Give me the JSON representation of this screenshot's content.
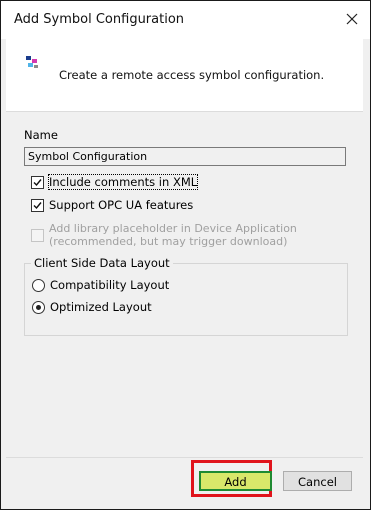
{
  "window": {
    "title": "Add Symbol Configuration"
  },
  "header": {
    "description": "Create a remote access symbol configuration.",
    "icon": "symbol-config-icon"
  },
  "name_field": {
    "label": "Name",
    "value": "Symbol Configuration"
  },
  "options": {
    "include_comments": {
      "label": "Include comments in XML",
      "checked": true
    },
    "support_opc_ua": {
      "label": "Support OPC UA features",
      "checked": true
    },
    "library_placeholder": {
      "label": "Add library placeholder in Device Application (recommended, but may trigger download)",
      "checked": false,
      "enabled": false
    }
  },
  "layout_group": {
    "legend": "Client Side Data Layout",
    "compatibility": {
      "label": "Compatibility Layout",
      "selected": false
    },
    "optimized": {
      "label": "Optimized Layout",
      "selected": true
    }
  },
  "buttons": {
    "add": "Add",
    "cancel": "Cancel"
  },
  "colors": {
    "highlight_border": "#e0141c",
    "add_button_bg": "#d9e86a",
    "add_button_border": "#1f8a32"
  }
}
